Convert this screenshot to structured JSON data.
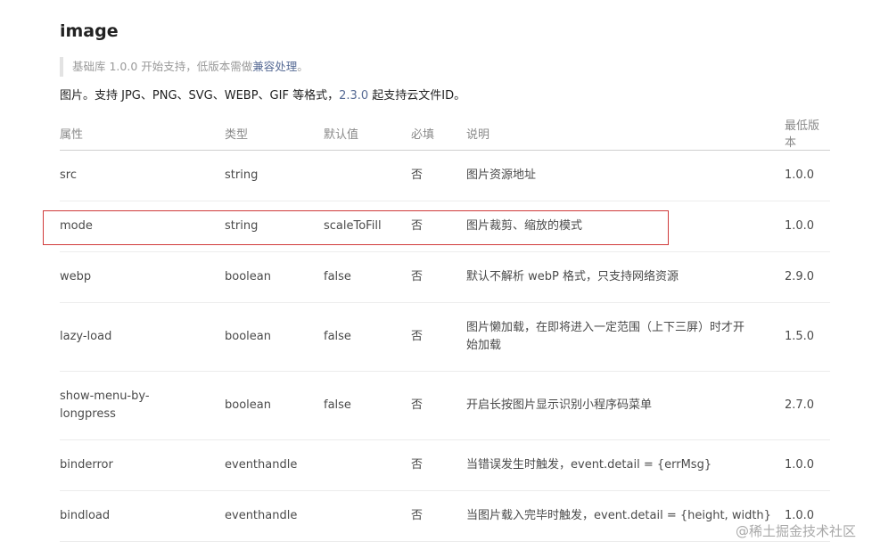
{
  "header": {
    "title": "image",
    "note_prefix": "基础库 1.0.0 开始支持，低版本需做",
    "note_link": "兼容处理",
    "note_suffix": "。",
    "desc_prefix": "图片。支持 JPG、PNG、SVG、WEBP、GIF 等格式，",
    "desc_link": "2.3.0",
    "desc_suffix": " 起支持云文件ID。"
  },
  "table": {
    "columns": [
      "属性",
      "类型",
      "默认值",
      "必填",
      "说明",
      "最低版本"
    ],
    "rows": [
      {
        "attr": "src",
        "type": "string",
        "default": "",
        "required": "否",
        "desc": "图片资源地址",
        "version": "1.0.0"
      },
      {
        "attr": "mode",
        "type": "string",
        "default": "scaleToFill",
        "required": "否",
        "desc": "图片裁剪、缩放的模式",
        "version": "1.0.0"
      },
      {
        "attr": "webp",
        "type": "boolean",
        "default": "false",
        "required": "否",
        "desc": "默认不解析 webP 格式，只支持网络资源",
        "version": "2.9.0"
      },
      {
        "attr": "lazy-load",
        "type": "boolean",
        "default": "false",
        "required": "否",
        "desc": "图片懒加载，在即将进入一定范围（上下三屏）时才开始加载",
        "version": "1.5.0"
      },
      {
        "attr": "show-menu-by-longpress",
        "type": "boolean",
        "default": "false",
        "required": "否",
        "desc": "开启长按图片显示识别小程序码菜单",
        "version": "2.7.0"
      },
      {
        "attr": "binderror",
        "type": "eventhandle",
        "default": "",
        "required": "否",
        "desc": "当错误发生时触发，event.detail = {errMsg}",
        "version": "1.0.0"
      },
      {
        "attr": "bindload",
        "type": "eventhandle",
        "default": "",
        "required": "否",
        "desc": "当图片载入完毕时触发，event.detail = {height, width}",
        "version": "1.0.0"
      }
    ]
  },
  "highlight": {
    "row": "mode",
    "color": "#d03a3a"
  },
  "watermark": "@稀土掘金技术社区",
  "colors": {
    "link": "#576b95",
    "header_text": "#8a8a8a",
    "body_text": "#4a4a4a"
  }
}
